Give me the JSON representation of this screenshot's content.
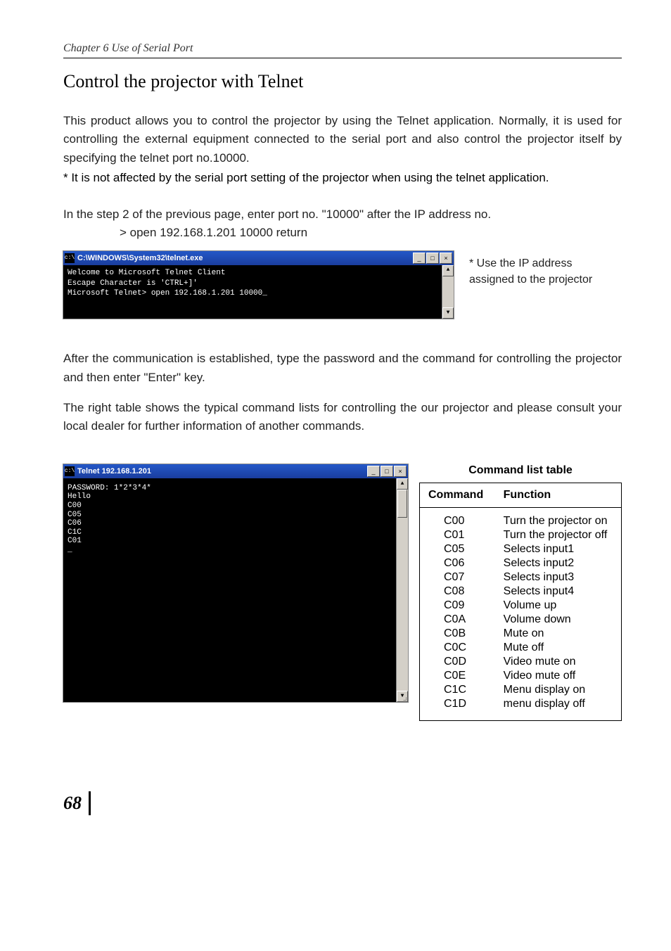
{
  "header": {
    "chapter": "Chapter 6 Use of Serial Port"
  },
  "section": {
    "title": "Control the projector with Telnet"
  },
  "para1": "This product allows you to control the projector by using the Telnet application. Normally, it is used for controlling the external equipment connected to the serial port and also control the projector itself by specifying the telnet port no.10000.",
  "note1": "* It is not affected by the serial port setting of the projector when using the telnet application.",
  "para2": "In the step 2 of the previous page, enter port no. \"10000\" after the IP address no.",
  "prompt": "> open 192.168.1.201 10000 return",
  "telnet1": {
    "title": "C:\\WINDOWS\\System32\\telnet.exe",
    "lines": [
      "Welcome to Microsoft Telnet Client",
      "Escape Character is 'CTRL+]'",
      "Microsoft Telnet> open 192.168.1.201 10000_"
    ]
  },
  "sidenote": "* Use the IP address assigned to the projector",
  "para3": "After the communication is established, type the password and the command for controlling the projector and then enter \"Enter\" key.",
  "para4": "The right table shows the typical command lists for controlling the our projector and please consult your local dealer for further information of another commands.",
  "telnet2": {
    "title": "Telnet 192.168.1.201",
    "lines": [
      "PASSWORD: 1*2*3*4*",
      "",
      "Hello",
      "C00",
      "C05",
      "C06",
      "C1C",
      "C01",
      "_"
    ]
  },
  "cmd_table": {
    "title": "Command list table",
    "headers": {
      "cmd": "Command",
      "fn": "Function"
    },
    "rows": [
      {
        "cmd": "C00",
        "fn": "Turn the projector on"
      },
      {
        "cmd": "C01",
        "fn": "Turn the projector off"
      },
      {
        "cmd": "C05",
        "fn": "Selects input1"
      },
      {
        "cmd": "C06",
        "fn": "Selects input2"
      },
      {
        "cmd": "C07",
        "fn": "Selects input3"
      },
      {
        "cmd": "C08",
        "fn": "Selects input4"
      },
      {
        "cmd": "C09",
        "fn": "Volume up"
      },
      {
        "cmd": "C0A",
        "fn": "Volume down"
      },
      {
        "cmd": "C0B",
        "fn": "Mute on"
      },
      {
        "cmd": "C0C",
        "fn": "Mute off"
      },
      {
        "cmd": "C0D",
        "fn": "Video mute on"
      },
      {
        "cmd": "C0E",
        "fn": "Video mute off"
      },
      {
        "cmd": "C1C",
        "fn": "Menu display on"
      },
      {
        "cmd": "C1D",
        "fn": "menu display off"
      }
    ]
  },
  "page_number": "68"
}
